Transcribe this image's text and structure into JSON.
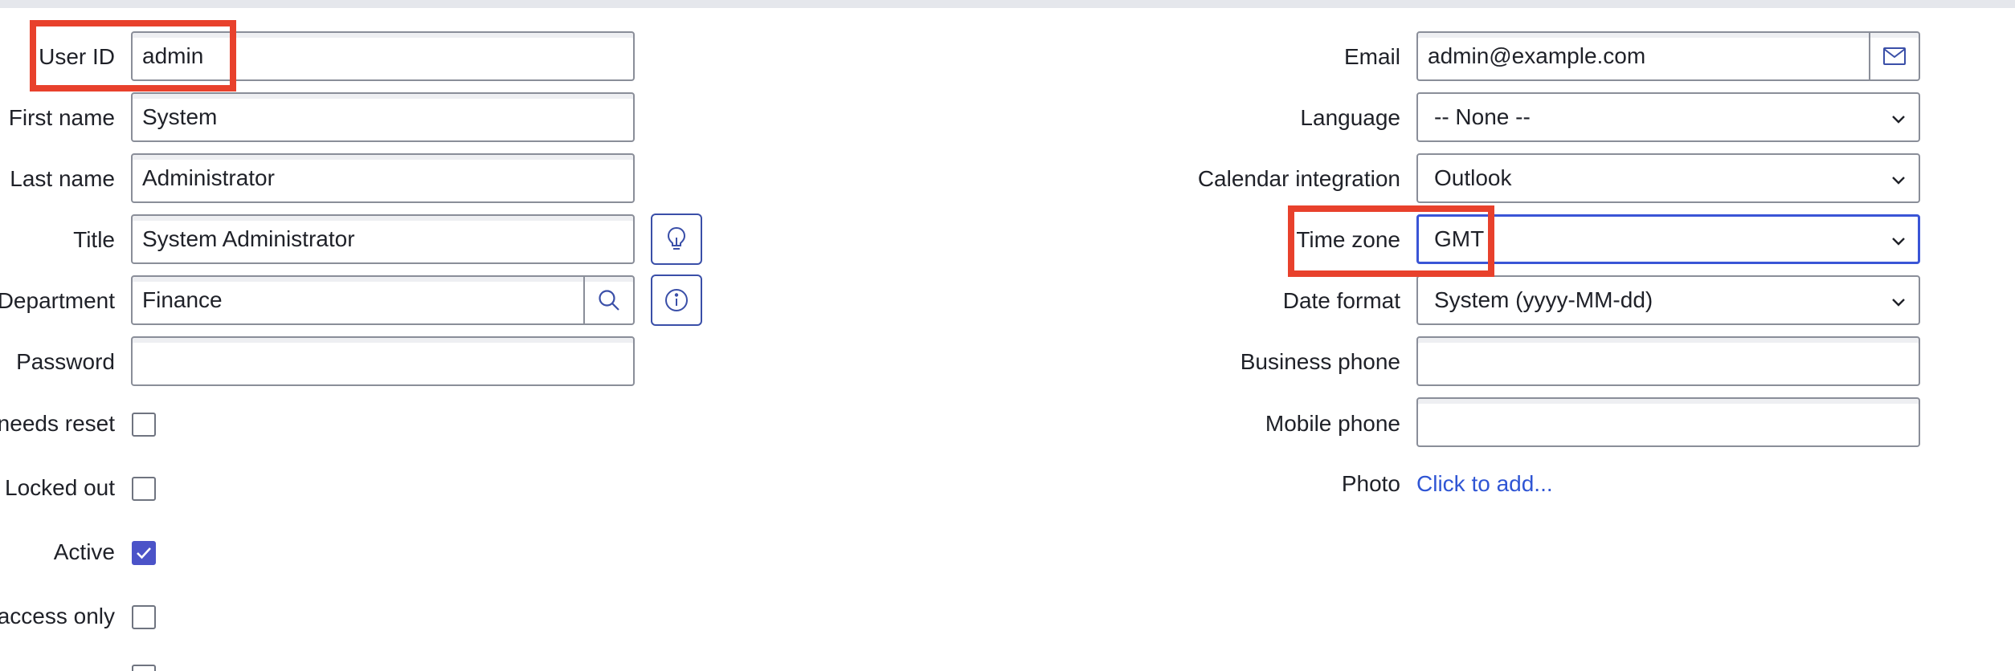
{
  "left_form": {
    "user_id": {
      "label": "User ID",
      "value": "admin"
    },
    "first_name": {
      "label": "First name",
      "value": "System"
    },
    "last_name": {
      "label": "Last name",
      "value": "Administrator"
    },
    "title": {
      "label": "Title",
      "value": "System Administrator"
    },
    "department": {
      "label": "Department",
      "value": "Finance"
    },
    "password": {
      "label": "Password",
      "value": ""
    },
    "password_needs_reset": {
      "label": "needs reset",
      "checked": false
    },
    "locked_out": {
      "label": "Locked out",
      "checked": false
    },
    "active": {
      "label": "Active",
      "checked": true
    },
    "access_only": {
      "label": "access only",
      "checked": false
    }
  },
  "right_form": {
    "email": {
      "label": "Email",
      "value": "admin@example.com"
    },
    "language": {
      "label": "Language",
      "value": "-- None --"
    },
    "calendar_integration": {
      "label": "Calendar integration",
      "value": "Outlook"
    },
    "time_zone": {
      "label": "Time zone",
      "value": "GMT"
    },
    "date_format": {
      "label": "Date format",
      "value": "System (yyyy-MM-dd)"
    },
    "business_phone": {
      "label": "Business phone",
      "value": ""
    },
    "mobile_phone": {
      "label": "Mobile phone",
      "value": ""
    },
    "photo": {
      "label": "Photo",
      "link": "Click to add..."
    }
  },
  "icons": {
    "email_button": "mail-icon",
    "title_suggest": "lightbulb-icon",
    "department_lookup": "search-icon",
    "department_info": "info-icon",
    "dropdown": "chevron-down-icon",
    "active_check": "check-icon"
  },
  "colors": {
    "highlight": "#e8412c",
    "focus_border": "#3a55d6",
    "checkbox_checked": "#4b53c8",
    "link": "#2f55d4"
  }
}
